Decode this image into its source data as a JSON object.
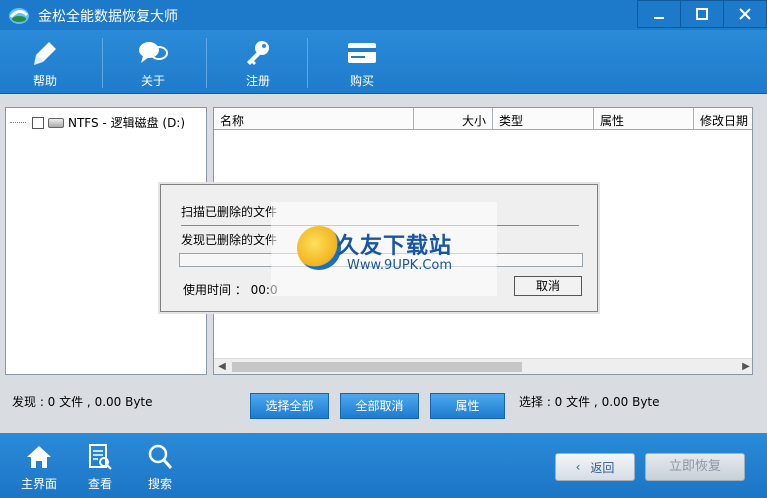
{
  "window": {
    "title": "金松全能数据恢复大师",
    "minimize_icon": "minimize-icon",
    "maximize_icon": "maximize-icon",
    "close_icon": "close-icon"
  },
  "toolbar": {
    "items": [
      {
        "label": "帮助",
        "icon": "pen-icon"
      },
      {
        "label": "关于",
        "icon": "chat-bubbles-icon"
      },
      {
        "label": "注册",
        "icon": "key-icon"
      },
      {
        "label": "购买",
        "icon": "card-icon"
      }
    ]
  },
  "tree": {
    "items": [
      {
        "label": "NTFS - 逻辑磁盘 (D:)",
        "checked": false
      }
    ]
  },
  "file_list": {
    "columns": [
      "名称",
      "大小",
      "类型",
      "属性",
      "修改日期"
    ],
    "rows": []
  },
  "scan_dialog": {
    "scanning_label": "扫描已删除的文件",
    "found_label": "发现已删除的文件",
    "elapsed_label": "使用时间 ： 00:0",
    "progress": 0,
    "cancel_label": "取消"
  },
  "watermark": {
    "title": "久友下载站",
    "url": "Www.9UPK.Com"
  },
  "status": {
    "found": "发现 : 0 文件 , 0.00 Byte",
    "selected": "选择 : 0 文件 , 0.00 Byte",
    "select_all_label": "选择全部",
    "deselect_all_label": "全部取消",
    "properties_label": "属性"
  },
  "bottom_nav": {
    "items": [
      {
        "label": "主界面",
        "icon": "home-icon"
      },
      {
        "label": "查看",
        "icon": "document-search-icon"
      },
      {
        "label": "搜索",
        "icon": "magnifier-icon"
      }
    ],
    "back_label": "返回",
    "recover_label": "立即恢复"
  },
  "colors": {
    "brand_blue": "#1d79c9",
    "watermark_blue": "#1756a6"
  }
}
